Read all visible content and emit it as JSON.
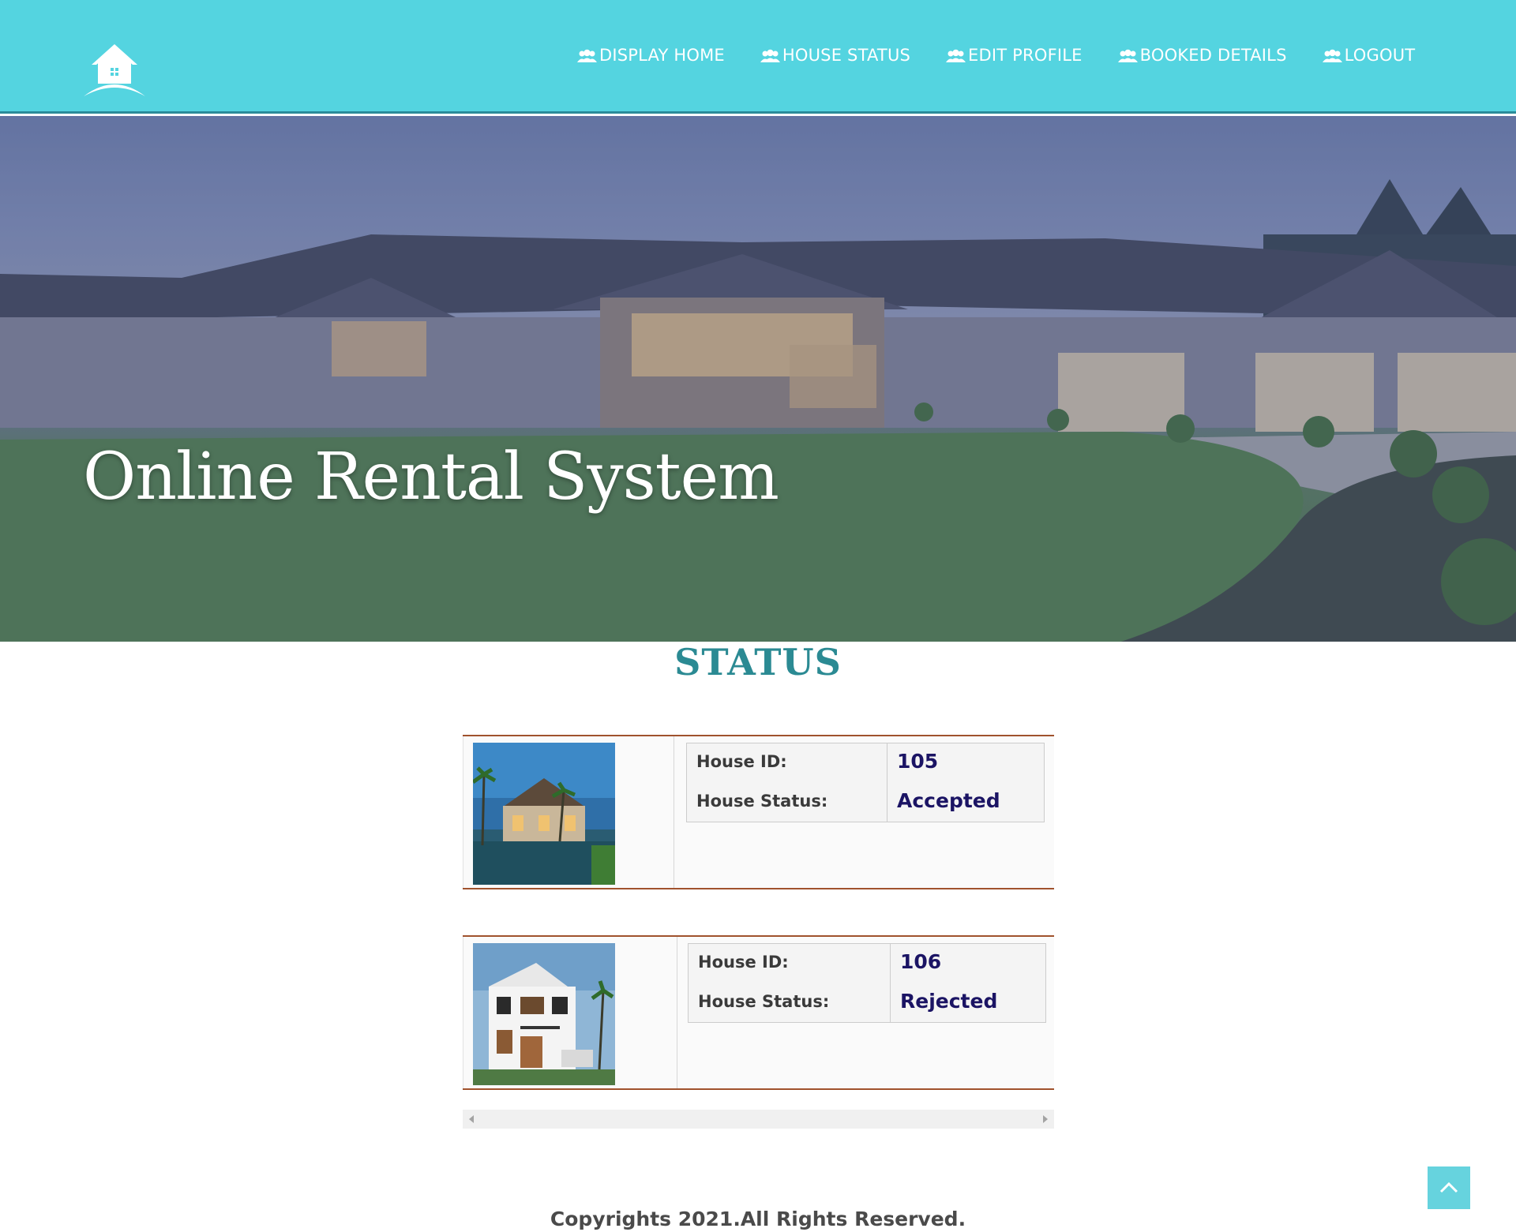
{
  "header": {
    "nav": [
      {
        "label": "DISPLAY HOME",
        "icon": "users-icon"
      },
      {
        "label": "HOUSE STATUS",
        "icon": "users-icon"
      },
      {
        "label": "EDIT PROFILE",
        "icon": "users-icon"
      },
      {
        "label": "BOOKED DETAILS",
        "icon": "users-icon"
      },
      {
        "label": "LOGOUT",
        "icon": "users-icon"
      }
    ],
    "logo_icon": "house-logo-icon",
    "color": "#54d4e0"
  },
  "hero": {
    "title": "Online Rental System"
  },
  "status": {
    "heading": "STATUS",
    "houses": [
      {
        "id_label": "House ID:",
        "id_value": "105",
        "status_label": "House Status:",
        "status_value": "Accepted"
      },
      {
        "id_label": "House ID:",
        "id_value": "106",
        "status_label": "House Status:",
        "status_value": "Rejected"
      }
    ]
  },
  "footer": {
    "copyright": "Copyrights 2021.All Rights Reserved."
  },
  "colors": {
    "accent": "#54d4e0",
    "heading": "#2b8a93",
    "value": "#1b1464",
    "card_border": "#a0522d"
  }
}
